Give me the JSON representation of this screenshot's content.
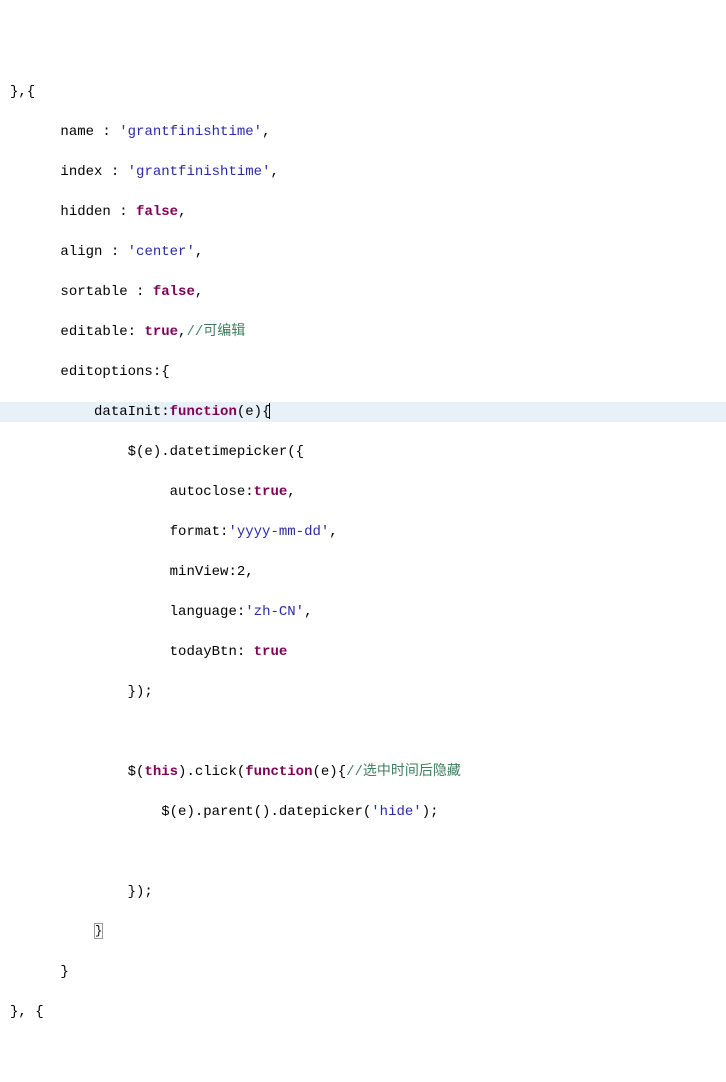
{
  "lines": {
    "l0": "},{",
    "l1_name": "name : ",
    "l1_val": "'grantfinishtime'",
    "l1_end": ",",
    "l2_name": "index : ",
    "l2_val": "'grantfinishtime'",
    "l2_end": ",",
    "l3_name": "hidden : ",
    "l3_val": "false",
    "l3_end": ",",
    "l4_name": "align : ",
    "l4_val": "'center'",
    "l4_end": ",",
    "l5_name": "sortable : ",
    "l5_val": "false",
    "l5_end": ",",
    "l6_name": "editable: ",
    "l6_val": "true",
    "l6_end": ",",
    "l6_comment": "//可编辑",
    "l7": "editoptions:{",
    "l8_a": "dataInit:",
    "l8_fn": "function",
    "l8_b": "(e){",
    "l9": "$(e).datetimepicker({",
    "l10_name": "autoclose:",
    "l10_val": "true",
    "l10_end": ",",
    "l11_name": "format:",
    "l11_val": "'yyyy-mm-dd'",
    "l11_end": ",",
    "l12_name": "minView:2,",
    "l13_name": "language:",
    "l13_val": "'zh-CN'",
    "l13_end": ",",
    "l14_name": "todayBtn: ",
    "l14_val": "true",
    "l15": "});",
    "l16_a": "$(",
    "l16_this": "this",
    "l16_b": ").click(",
    "l16_fn": "function",
    "l16_c": "(e){",
    "l16_comment": "//选中时间后隐藏",
    "l17_a": "$(e).parent().datepicker(",
    "l17_val": "'hide'",
    "l17_b": ");",
    "l18": "});",
    "l19": "}",
    "l20": "}",
    "l21": "}, {"
  }
}
